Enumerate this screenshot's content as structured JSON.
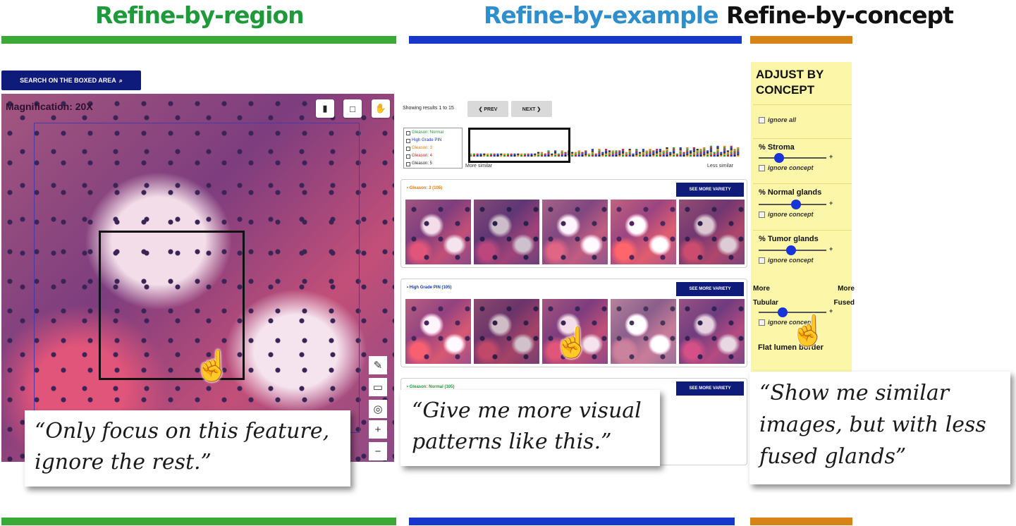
{
  "sections": [
    {
      "title": "Refine-by-region",
      "color": "#1f9a3b",
      "bar_color": "#3aa935"
    },
    {
      "title": "Refine-by-example",
      "color": "#2f8fcc",
      "bar_color": "#1736cc"
    },
    {
      "title": "Refine-by-concept",
      "color": "#111111",
      "bar_color": "#d78416"
    }
  ],
  "region": {
    "search_button_label": "SEARCH ON THE BOXED AREA",
    "search_icon": "search-icon",
    "magnification": "Magnification: 20X",
    "tools": [
      "trash-icon",
      "square-icon",
      "hand-icon"
    ],
    "side_tools": [
      "edit-icon",
      "window-icon",
      "target-icon",
      "plus-icon",
      "minus-icon"
    ],
    "quote": "“Only focus on this feature, ignore the rest.”"
  },
  "example": {
    "results_text": "Showing results 1 to 15",
    "prev_label": "❮ PREV",
    "next_label": "NEXT ❯",
    "legend": [
      {
        "label": "Gleason: Normal",
        "color": "#1f9a3b"
      },
      {
        "label": "High Grade PIN",
        "color": "#1736cc"
      },
      {
        "label": "Gleason: 3",
        "color": "#e07a10"
      },
      {
        "label": "Gleason: 4",
        "color": "#d01c1c"
      },
      {
        "label": "Gleason: 5",
        "color": "#222222"
      }
    ],
    "more_similar": "More similar",
    "less_similar": "Less similar",
    "groups": [
      {
        "label": "• Gleason: 3 (105)",
        "color": "#e07a10",
        "button": "SEE MORE VARIETY"
      },
      {
        "label": "• High Grade PIN (105)",
        "color": "#1736cc",
        "button": "SEE MORE VARIETY"
      },
      {
        "label": "• Gleason: Normal (105)",
        "color": "#1f9a3b",
        "button": "SEE MORE VARIETY"
      }
    ],
    "quote": "“Give me more visual patterns like this.”"
  },
  "concept": {
    "title": "ADJUST BY CONCEPT",
    "ignore_all": "ignore all",
    "sliders": [
      {
        "label": "% Stroma",
        "ignore": "ignore concept",
        "value": 0.3
      },
      {
        "label": "% Normal glands",
        "ignore": "ignore concept",
        "value": 0.55
      },
      {
        "label": "% Tumor glands",
        "ignore": "ignore concept",
        "value": 0.48
      }
    ],
    "more_tubular": "More Tubular",
    "more_fused": "More Fused",
    "tubular_value": 0.35,
    "tubular_ignore": "ignore concept",
    "flat_lumen": "Flat lumen border",
    "quote": "“Show me similar images, but with less fused glands”"
  }
}
